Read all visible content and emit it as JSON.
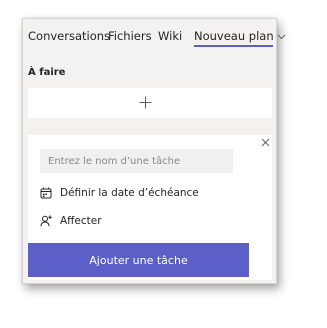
{
  "tabs": [
    {
      "label": "Conversations"
    },
    {
      "label": "Fichiers"
    },
    {
      "label": "Wiki"
    },
    {
      "label": "Nouveau plan"
    }
  ],
  "active_tab": "Nouveau plan",
  "icons": {
    "tab_dropdown": "chevron-down-icon",
    "add": "plus-icon",
    "close": "close-icon",
    "due_date": "calendar-icon",
    "assign": "add-person-icon"
  },
  "colors": {
    "accent": "#5b5fc7",
    "panel_bg": "#f3f2f1",
    "card_bg": "#ffffff",
    "input_bg": "#f0f0f0"
  },
  "bucket": {
    "title": "À faire"
  },
  "task_form": {
    "name_placeholder": "Entrez le nom d’une tâche",
    "due_date_label": "Définir la date d’échéance",
    "assign_label": "Affecter",
    "submit_label": "Ajouter une tâche"
  }
}
